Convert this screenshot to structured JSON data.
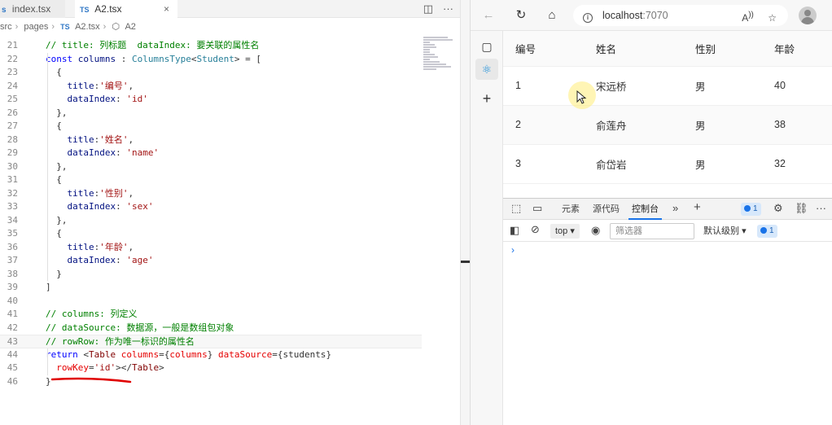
{
  "editor": {
    "tabs": [
      {
        "label": "index.tsx",
        "prefix": "s"
      },
      {
        "label": "A2.tsx",
        "prefix": "TS",
        "close": "×"
      }
    ],
    "breadcrumb": [
      "src",
      "pages",
      "A2.tsx",
      "A2"
    ],
    "lines": [
      {
        "n": "21",
        "text": "// title: 列标题  dataIndex: 要关联的属性名"
      },
      {
        "n": "22",
        "text": "const columns : ColumnsType<Student> = ["
      },
      {
        "n": "23",
        "text": "  {"
      },
      {
        "n": "24",
        "text": "    title:'编号',"
      },
      {
        "n": "25",
        "text": "    dataIndex: 'id'"
      },
      {
        "n": "26",
        "text": "  },"
      },
      {
        "n": "27",
        "text": "  {"
      },
      {
        "n": "28",
        "text": "    title:'姓名',"
      },
      {
        "n": "29",
        "text": "    dataIndex: 'name'"
      },
      {
        "n": "30",
        "text": "  },"
      },
      {
        "n": "31",
        "text": "  {"
      },
      {
        "n": "32",
        "text": "    title:'性别',"
      },
      {
        "n": "33",
        "text": "    dataIndex: 'sex'"
      },
      {
        "n": "34",
        "text": "  },"
      },
      {
        "n": "35",
        "text": "  {"
      },
      {
        "n": "36",
        "text": "    title:'年龄',"
      },
      {
        "n": "37",
        "text": "    dataIndex: 'age'"
      },
      {
        "n": "38",
        "text": "  }"
      },
      {
        "n": "39",
        "text": "]"
      },
      {
        "n": "40",
        "text": ""
      },
      {
        "n": "41",
        "text": "// columns: 列定义"
      },
      {
        "n": "42",
        "text": "// dataSource: 数据源，一般是数组包对象"
      },
      {
        "n": "43",
        "text": "// rowRow: 作为唯一标识的属性名"
      },
      {
        "n": "44",
        "text": "return <Table columns={columns} dataSource={students}"
      },
      {
        "n": "45",
        "text": "  rowKey='id'></Table>"
      },
      {
        "n": "46",
        "text": "}"
      }
    ]
  },
  "browser": {
    "url_host": "localhost",
    "url_port": ":7070",
    "table": {
      "headers": [
        "编号",
        "姓名",
        "性别",
        "年龄"
      ],
      "rows": [
        [
          "1",
          "宋远桥",
          "男",
          "40"
        ],
        [
          "2",
          "俞莲舟",
          "男",
          "38"
        ],
        [
          "3",
          "俞岱岩",
          "男",
          "32"
        ]
      ]
    },
    "devtools": {
      "tabs": [
        "元素",
        "源代码",
        "控制台"
      ],
      "active_tab": "控制台",
      "issues_count": "1",
      "context_select": "top",
      "filter_placeholder": "筛选器",
      "level_select": "默认级别",
      "messages_count": "1",
      "prompt": "›"
    }
  },
  "colors": {
    "comment": "#008000",
    "keyword": "#0000ff",
    "string": "#a31515",
    "accent": "#1a73e8",
    "annotation": "#e00000"
  }
}
